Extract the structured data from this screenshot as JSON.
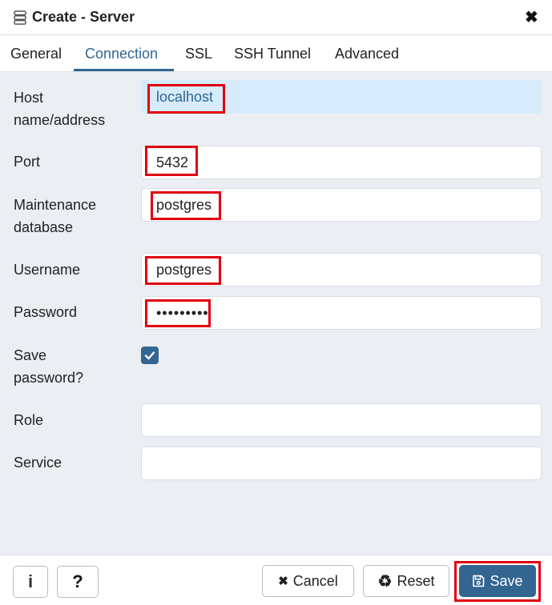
{
  "dialog": {
    "title": "Create - Server",
    "close_glyph": "✖"
  },
  "tabs": [
    {
      "label": "General",
      "active": false
    },
    {
      "label": "Connection",
      "active": true
    },
    {
      "label": "SSL",
      "active": false
    },
    {
      "label": "SSH Tunnel",
      "active": false
    },
    {
      "label": "Advanced",
      "active": false
    }
  ],
  "form": {
    "host": {
      "label_line1": "Host",
      "label_line2": "name/address",
      "value": "localhost"
    },
    "port": {
      "label": "Port",
      "value": "5432"
    },
    "maintenance_db": {
      "label_line1": "Maintenance",
      "label_line2": "database",
      "value": "postgres"
    },
    "username": {
      "label": "Username",
      "value": "postgres"
    },
    "password": {
      "label": "Password",
      "value": "•••••••••"
    },
    "save_password": {
      "label_line1": "Save",
      "label_line2": "password?",
      "checked": true
    },
    "role": {
      "label": "Role",
      "value": ""
    },
    "service": {
      "label": "Service",
      "value": ""
    }
  },
  "footer": {
    "info_glyph": "i",
    "help_glyph": "?",
    "cancel_glyph": "✖",
    "cancel_label": "Cancel",
    "reset_glyph": "♻",
    "reset_label": "Reset",
    "save_label": "Save"
  },
  "colors": {
    "accent": "#326690",
    "highlight_red": "#e0000f",
    "host_field_bg": "#d6ecfa"
  },
  "icons": [
    "server-icon",
    "close-icon",
    "checkmark-icon",
    "info-icon",
    "question-icon",
    "times-icon",
    "recycle-icon",
    "floppy-disk-icon"
  ]
}
